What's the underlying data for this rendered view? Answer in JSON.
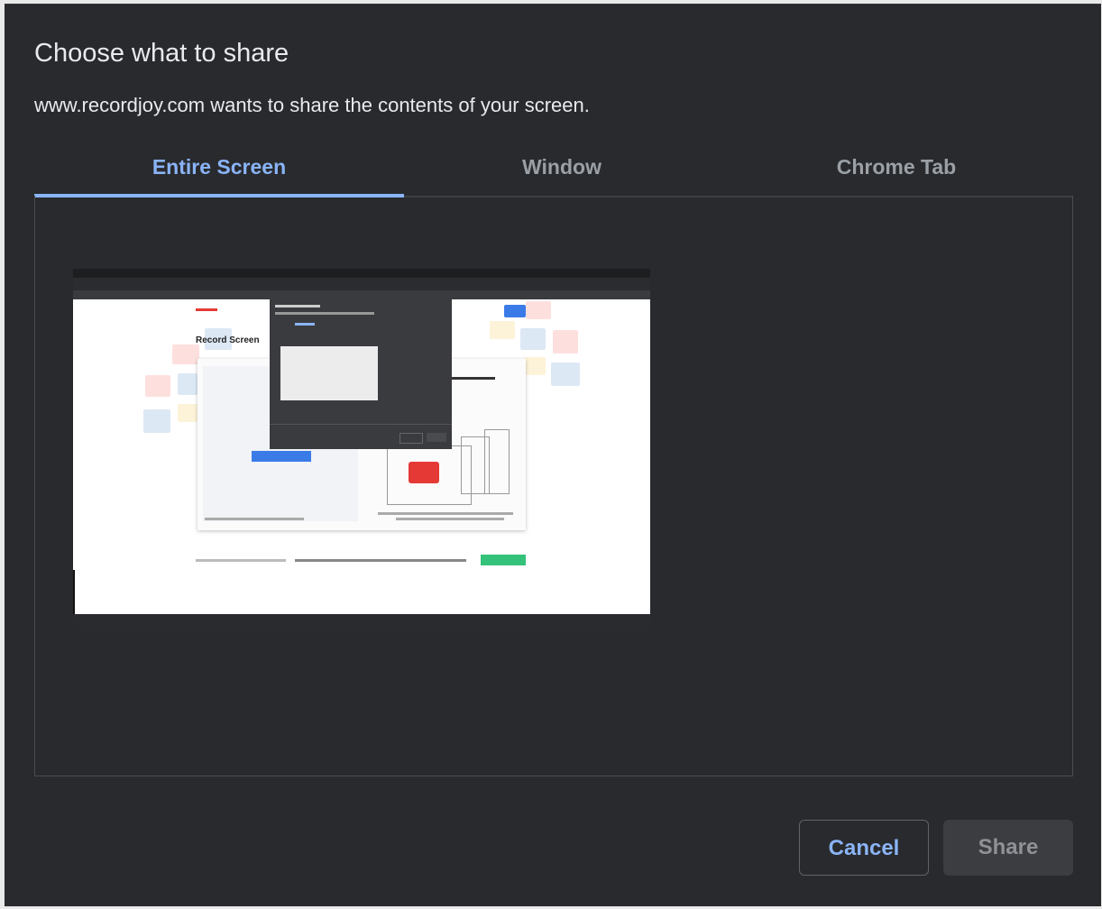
{
  "dialog": {
    "title": "Choose what to share",
    "subtitle": "www.recordjoy.com wants to share the contents of your screen."
  },
  "tabs": [
    {
      "label": "Entire Screen",
      "active": true
    },
    {
      "label": "Window",
      "active": false
    },
    {
      "label": "Chrome Tab",
      "active": false
    }
  ],
  "preview": {
    "label": "Record Screen"
  },
  "buttons": {
    "cancel": "Cancel",
    "share": "Share"
  },
  "colors": {
    "background": "#292a2d",
    "accent": "#8ab4f8",
    "text": "#e8eaed",
    "tab_inactive": "#9aa0a6"
  }
}
